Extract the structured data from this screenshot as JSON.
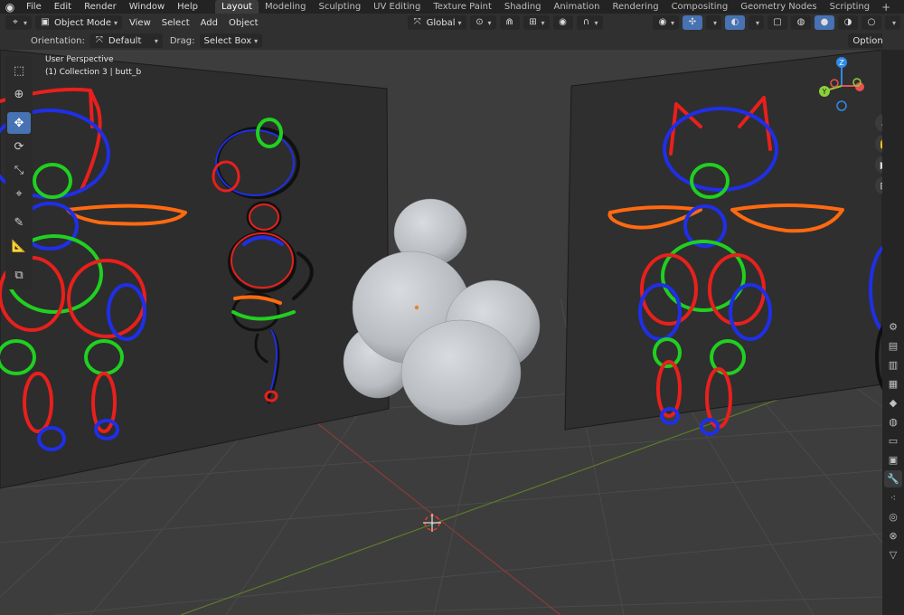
{
  "topbar": {
    "menus": [
      "File",
      "Edit",
      "Render",
      "Window",
      "Help"
    ],
    "workspaces": [
      "Layout",
      "Modeling",
      "Sculpting",
      "UV Editing",
      "Texture Paint",
      "Shading",
      "Animation",
      "Rendering",
      "Compositing",
      "Geometry Nodes",
      "Scripting"
    ],
    "active_workspace": "Layout",
    "add_tab": "+"
  },
  "header": {
    "mode": "Object Mode",
    "menus": [
      "View",
      "Select",
      "Add",
      "Object"
    ],
    "transform_orientation": "Global"
  },
  "tool_header": {
    "orientation_label": "Orientation:",
    "orientation_value": "Default",
    "drag_label": "Drag:",
    "drag_value": "Select Box",
    "options_label": "Options"
  },
  "viewport": {
    "view_name": "User Perspective",
    "active_object": "(1) Collection 3 | butt_b",
    "gizmo": {
      "z": "Z",
      "y": "Y"
    }
  },
  "colors": {
    "stroke_red": "#e8201c",
    "stroke_green": "#20d020",
    "stroke_blue": "#1f2fe8",
    "stroke_orange": "#ff6a10",
    "stroke_black": "#101010",
    "active_tool": "#4772b3",
    "axis_x": "#e8514f",
    "axis_y": "#8ccf3a",
    "axis_z": "#2e8ae8"
  }
}
